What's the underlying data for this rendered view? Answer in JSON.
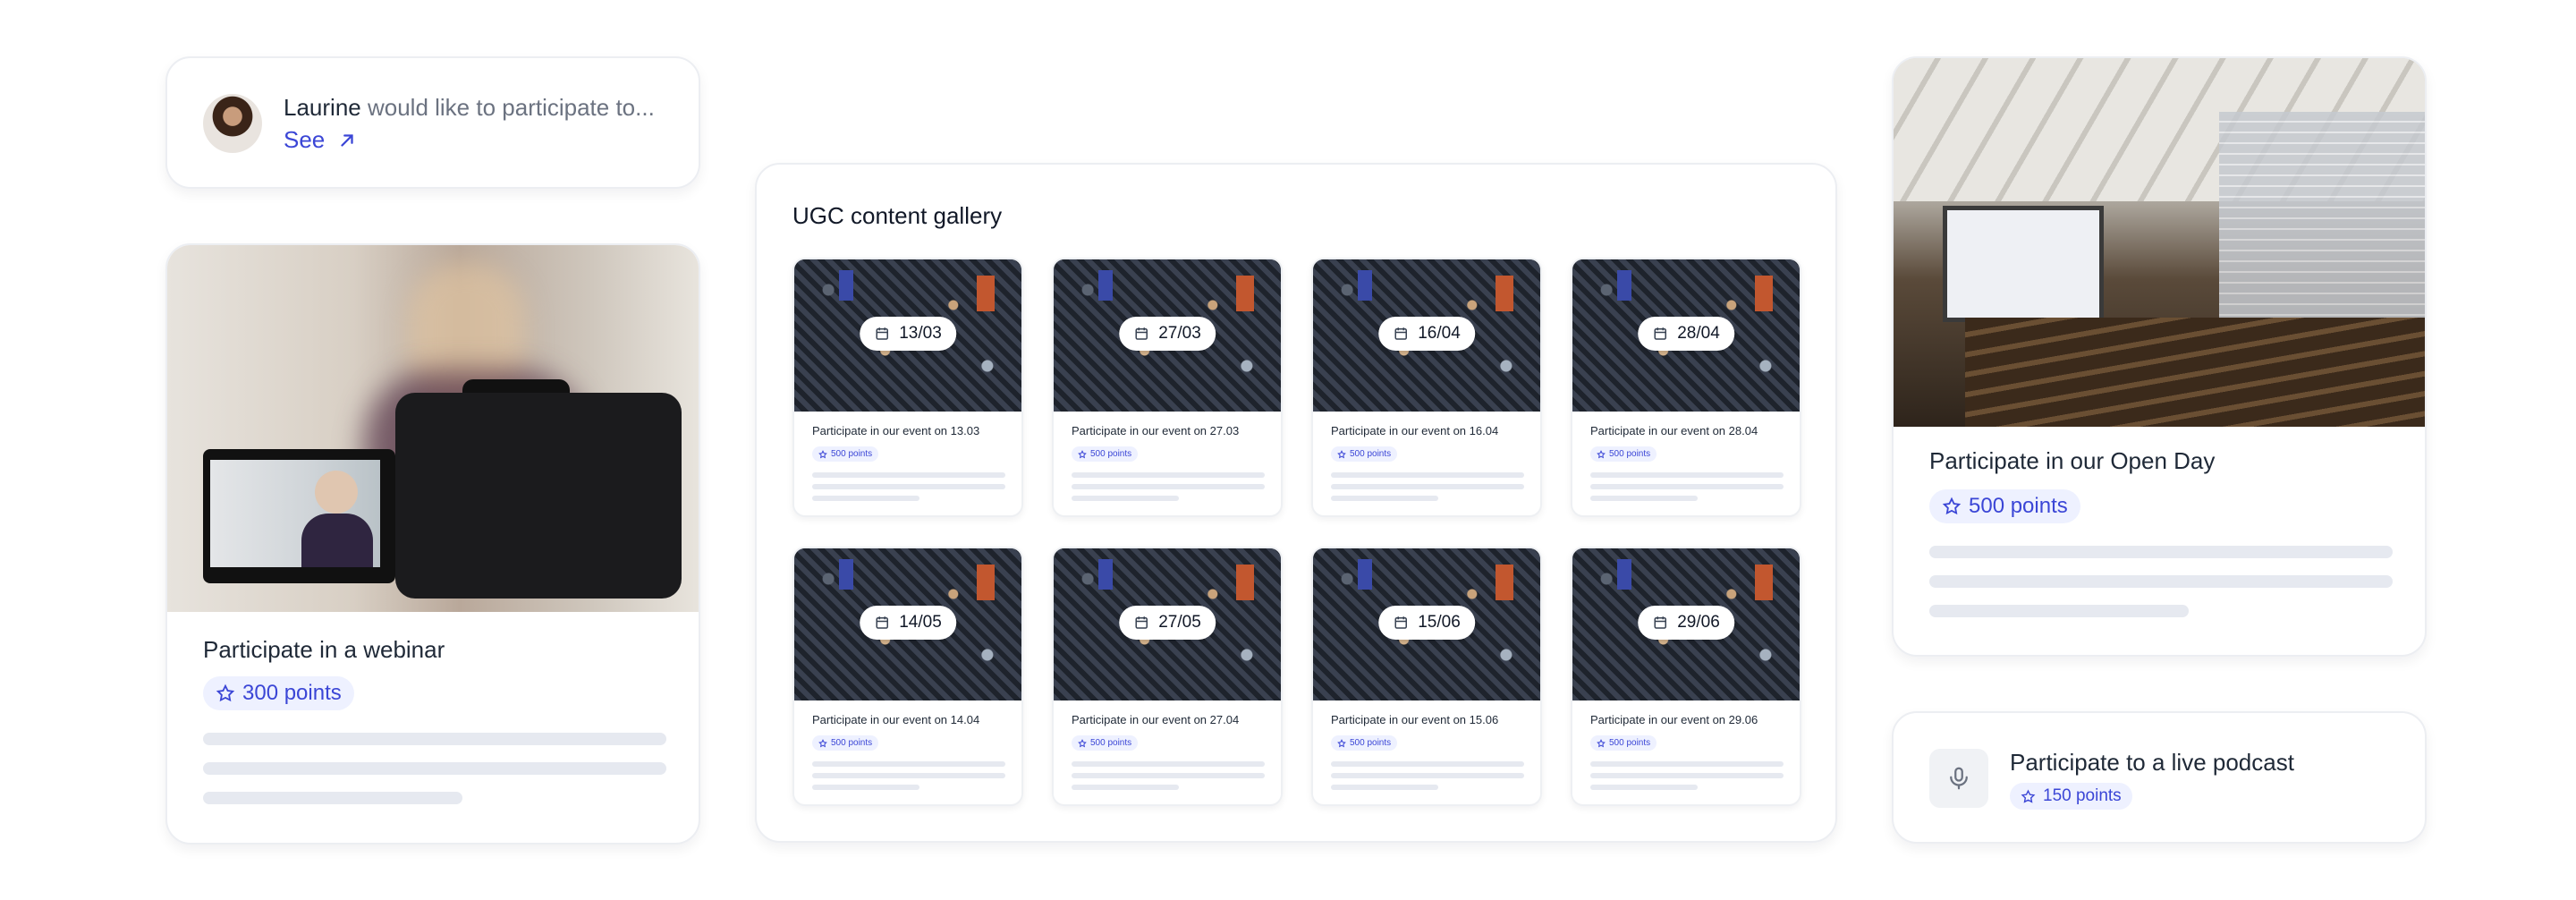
{
  "notification": {
    "user": "Laurine",
    "message": "would like to participate to...",
    "link_label": "See"
  },
  "webinar": {
    "title": "Participate in a webinar",
    "points": "300 points"
  },
  "gallery": {
    "title": "UGC content gallery",
    "items": [
      {
        "date": "13/03",
        "text": "Participate in our event on 13.03",
        "points": "500 points"
      },
      {
        "date": "27/03",
        "text": "Participate in our event on 27.03",
        "points": "500 points"
      },
      {
        "date": "16/04",
        "text": "Participate in our event on 16.04",
        "points": "500 points"
      },
      {
        "date": "28/04",
        "text": "Participate in our event on 28.04",
        "points": "500 points"
      },
      {
        "date": "14/05",
        "text": "Participate in our event on 14.04",
        "points": "500 points"
      },
      {
        "date": "27/05",
        "text": "Participate in our event on 27.04",
        "points": "500 points"
      },
      {
        "date": "15/06",
        "text": "Participate in our event on 15.06",
        "points": "500 points"
      },
      {
        "date": "29/06",
        "text": "Participate in our event on 29.06",
        "points": "500 points"
      }
    ]
  },
  "open_day": {
    "title": "Participate in our Open Day",
    "points": "500 points"
  },
  "podcast": {
    "title": "Participate to a live podcast",
    "points": "150 points"
  },
  "icons": {
    "star": "star-icon",
    "calendar": "calendar-icon",
    "arrow": "arrow-up-right-icon",
    "microphone": "microphone-icon"
  },
  "colors": {
    "accent": "#3b46d6",
    "badge_bg": "#eef1ff",
    "skeleton": "#e6e9f0"
  }
}
